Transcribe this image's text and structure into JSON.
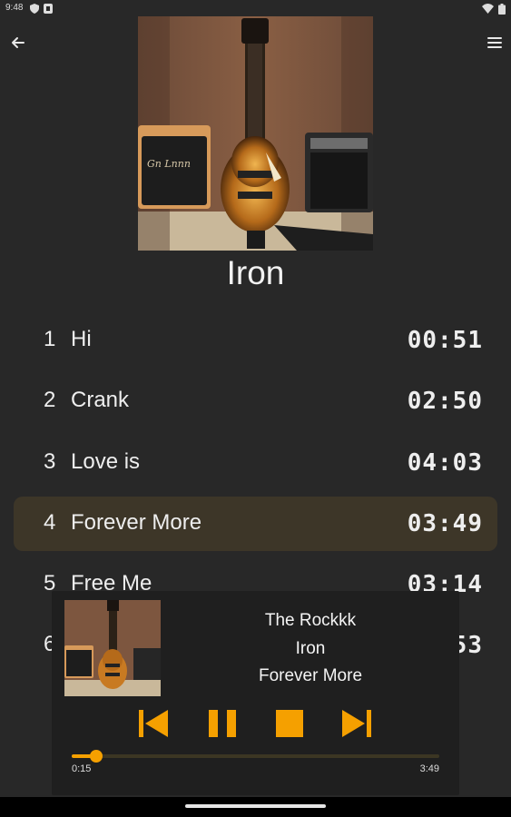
{
  "status_bar": {
    "time": "9:48",
    "left_icons": [
      "shield-icon",
      "badge-icon"
    ],
    "right_icons": [
      "wifi-icon",
      "battery-icon"
    ]
  },
  "top_bar": {
    "back_icon": "arrow-left-icon",
    "menu_icon": "hamburger-menu-icon"
  },
  "album": {
    "art_icon": "guitar-album-art",
    "title": "Iron"
  },
  "tracks": [
    {
      "num": "1",
      "name": "Hi",
      "duration": "00:51",
      "active": false
    },
    {
      "num": "2",
      "name": "Crank",
      "duration": "02:50",
      "active": false
    },
    {
      "num": "3",
      "name": "Love is",
      "duration": "04:03",
      "active": false
    },
    {
      "num": "4",
      "name": "Forever More",
      "duration": "03:49",
      "active": true
    },
    {
      "num": "5",
      "name": "Free Me",
      "duration": "03:14",
      "active": false
    },
    {
      "num": "6",
      "name": "",
      "duration": ":53",
      "active": false
    }
  ],
  "player": {
    "artist": "The Rockkk",
    "album": "Iron",
    "track": "Forever More",
    "controls": [
      "skip-previous-icon",
      "pause-icon",
      "stop-icon",
      "skip-next-icon"
    ],
    "current_time": "0:15",
    "total_time": "3:49",
    "progress": 0.066
  },
  "colors": {
    "background": "#282828",
    "accent": "#f5a000",
    "active_row": "#3d3628",
    "player_bg": "#1f1f1f"
  }
}
